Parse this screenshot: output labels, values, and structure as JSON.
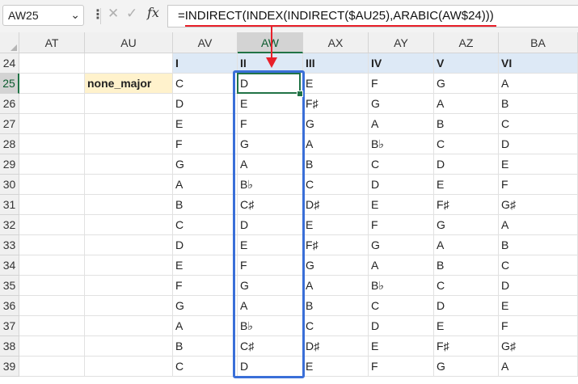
{
  "name_box": {
    "value": "AW25",
    "caret": "⌄"
  },
  "formula_bar": {
    "more_icon": "⋮",
    "cancel_icon": "✕",
    "enter_icon": "✓",
    "fx_icon": "fx",
    "formula": "=INDIRECT(INDEX(INDIRECT($AU25),ARABIC(AW$24)))"
  },
  "columns": [
    "AT",
    "AU",
    "AV",
    "AW",
    "AX",
    "AY",
    "AZ",
    "BA"
  ],
  "selected_column": "AW",
  "rows": [
    "24",
    "25",
    "26",
    "27",
    "28",
    "29",
    "30",
    "31",
    "32",
    "33",
    "34",
    "35",
    "36",
    "37",
    "38",
    "39"
  ],
  "selected_row": "25",
  "header_row": [
    "I",
    "II",
    "III",
    "IV",
    "V",
    "VI"
  ],
  "label_cell": "none_major",
  "scale_rows": [
    [
      "C",
      "D",
      "E",
      "F",
      "G",
      "A"
    ],
    [
      "D",
      "E",
      "F♯",
      "G",
      "A",
      "B"
    ],
    [
      "E",
      "F",
      "G",
      "A",
      "B",
      "C"
    ],
    [
      "F",
      "G",
      "A",
      "B♭",
      "C",
      "D"
    ],
    [
      "G",
      "A",
      "B",
      "C",
      "D",
      "E"
    ],
    [
      "A",
      "B♭",
      "C",
      "D",
      "E",
      "F"
    ],
    [
      "B",
      "C♯",
      "D♯",
      "E",
      "F♯",
      "G♯"
    ],
    [
      "C",
      "D",
      "E",
      "F",
      "G",
      "A"
    ],
    [
      "D",
      "E",
      "F♯",
      "G",
      "A",
      "B"
    ],
    [
      "E",
      "F",
      "G",
      "A",
      "B",
      "C"
    ],
    [
      "F",
      "G",
      "A",
      "B♭",
      "C",
      "D"
    ],
    [
      "G",
      "A",
      "B",
      "C",
      "D",
      "E"
    ],
    [
      "A",
      "B♭",
      "C",
      "D",
      "E",
      "F"
    ],
    [
      "B",
      "C♯",
      "D♯",
      "E",
      "F♯",
      "G♯"
    ],
    [
      "C",
      "D",
      "E",
      "F",
      "G",
      "A"
    ]
  ],
  "colors": {
    "header_fill": "#dde9f6",
    "label_fill": "#fff2cc",
    "selection": "#217346",
    "highlight_frame": "#3a6fd8",
    "annotation": "#e8202a"
  }
}
